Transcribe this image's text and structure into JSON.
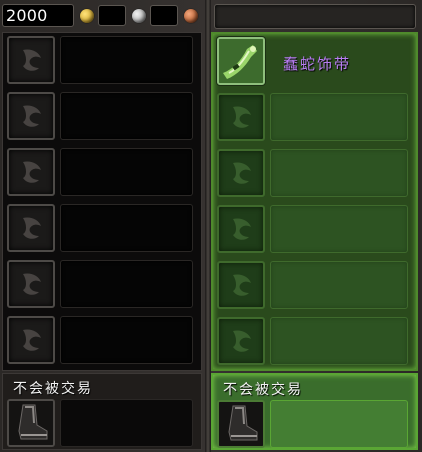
{
  "player_money": {
    "gold_amount": "2000",
    "currency_icons": [
      "gold-coin-icon",
      "silver-coin-icon",
      "copper-coin-icon"
    ],
    "colors": {
      "gold": "#d9b23a",
      "silver": "#b9b9b9",
      "copper": "#c0693c"
    }
  },
  "left_panel": {
    "slots": [
      {
        "item": ""
      },
      {
        "item": ""
      },
      {
        "item": ""
      },
      {
        "item": ""
      },
      {
        "item": ""
      },
      {
        "item": ""
      }
    ],
    "no_trade": {
      "title": "不会被交易",
      "icon": "boot-icon"
    }
  },
  "right_panel": {
    "slots": [
      {
        "item": "蠢蛇饰带",
        "icon": "green-belt-icon",
        "color": "#b77cf1"
      },
      {
        "item": ""
      },
      {
        "item": ""
      },
      {
        "item": ""
      },
      {
        "item": ""
      },
      {
        "item": ""
      }
    ],
    "no_trade": {
      "title": "不会被交易",
      "icon": "boot-icon"
    }
  },
  "accents": {
    "ready_green": "#4f8a2c",
    "epic_purple": "#b77cf1"
  }
}
